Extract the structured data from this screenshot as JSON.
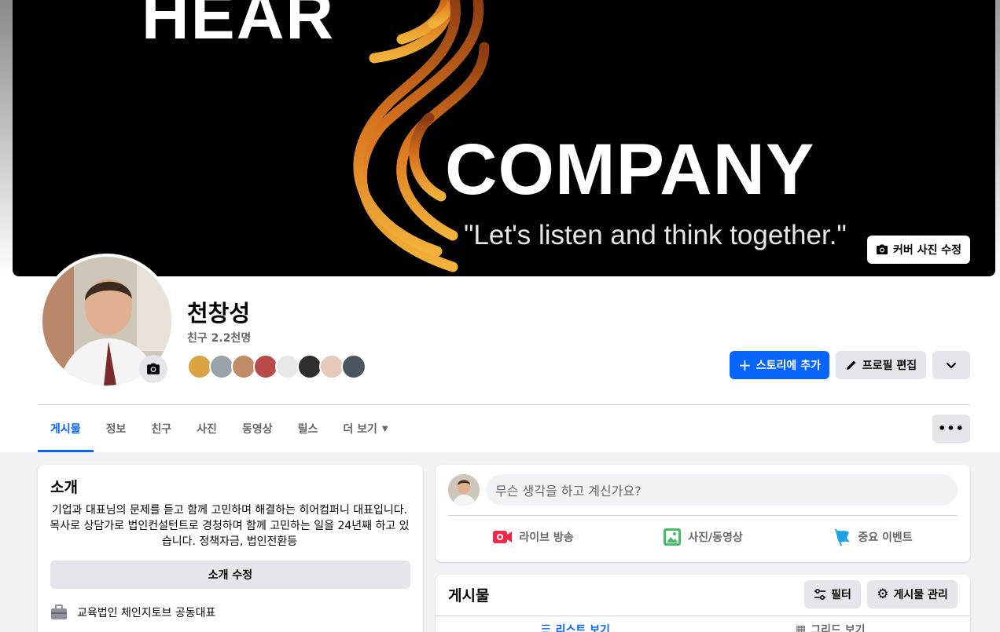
{
  "cover": {
    "word1": "HEAR",
    "word2": "COMPANY",
    "tagline": "\"Let's listen and think together.\"",
    "edit_label": "커버 사진 수정"
  },
  "profile": {
    "name": "천창성",
    "friends": "친구 2.2천명"
  },
  "actions": {
    "add_story": "스토리에 추가",
    "edit_profile": "프로필 편집"
  },
  "tabs": [
    {
      "label": "게시물",
      "active": true
    },
    {
      "label": "정보"
    },
    {
      "label": "친구"
    },
    {
      "label": "사진"
    },
    {
      "label": "동영상"
    },
    {
      "label": "릴스"
    },
    {
      "label": "더 보기"
    }
  ],
  "intro": {
    "title": "소개",
    "bio": "기업과 대표님의 문제를 듣고 함께 고민하며 해결하는 히어컴퍼니 대표입니다. 목사로 상담가로 법인컨설턴트로 경청하며 함께 고민하는 일을 24년째 하고 있습니다. 정책자금, 법인전환등",
    "edit_label": "소개 수정",
    "work": "교육법인 체인지토브 공동대표"
  },
  "composer": {
    "placeholder": "무슨 생각을 하고 계신가요?",
    "live": "라이브 방송",
    "photo": "사진/동영상",
    "event": "중요 이벤트"
  },
  "posts": {
    "title": "게시물",
    "filter": "필터",
    "manage": "게시물 관리",
    "list_view": "리스트 보기",
    "grid_view": "그리드 보기"
  },
  "colors": {
    "accent": "#0866ff",
    "live_red": "#f02849",
    "photo_green": "#45bd62",
    "event_blue": "#1aa3e8"
  }
}
